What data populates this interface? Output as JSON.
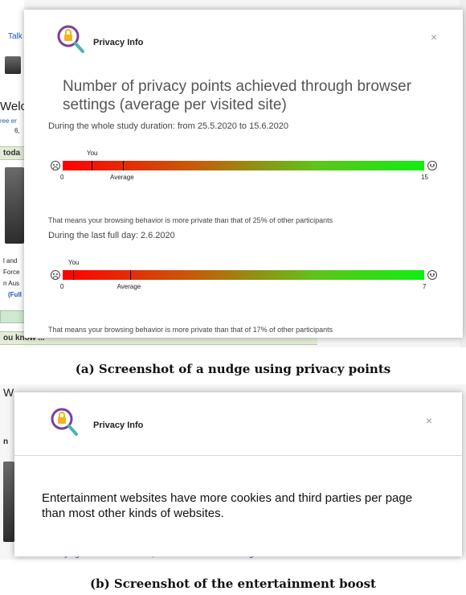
{
  "panel_a": {
    "background": {
      "tab": "Talk",
      "welcome": "Welc",
      "line1": "ree er",
      "line2": "6,",
      "section": "toda",
      "snip1": "l and",
      "snip2": "Force",
      "snip3": "n Aus",
      "snip4": "(Full",
      "footer": "ou know ..."
    },
    "modal": {
      "title": "Privacy Info",
      "close_symbol": "×",
      "heading": "Number of privacy points achieved through browser settings (average per visited site)",
      "section1": {
        "label": "During the whole study duration: from 25.5.2020 to 15.6.2020",
        "you_label": "You",
        "min": "0",
        "max": "15",
        "average_label": "Average",
        "you_value": 1.2,
        "average_value": 2.5,
        "scale_max": 15,
        "note": "That means your browsing behavior is more private than that of 25% of other participants"
      },
      "section2": {
        "label": "During the last full day: 2.6.2020",
        "you_label": "You",
        "min": "0",
        "max": "7",
        "average_label": "Average",
        "you_value": 0.2,
        "average_value": 1.3,
        "scale_max": 7,
        "note": "That means your browsing behavior is more private than that of 17% of other participants"
      }
    }
  },
  "caption_a": "(a) Screenshot of a nudge using privacy points",
  "panel_b": {
    "background": {
      "top": "W",
      "left1": "n",
      "bottom_text": "Flying Cross. After the war, Hancock became the inaugural commandant"
    },
    "modal": {
      "title": "Privacy Info",
      "close_symbol": "×",
      "message": "Entertainment websites have more cookies and third parties per page than most other kinds of websites."
    }
  },
  "caption_b": "(b) Screenshot of the entertainment boost",
  "colors": {
    "logo_ring": "#7b3f98",
    "logo_lock": "#f2b51a",
    "logo_handle": "#4fb3b3",
    "bar_start": "#ff0000",
    "bar_end": "#11ee11"
  },
  "icons": [
    "privacy-lens-icon",
    "close-icon",
    "sad-face-icon",
    "happy-face-icon"
  ]
}
